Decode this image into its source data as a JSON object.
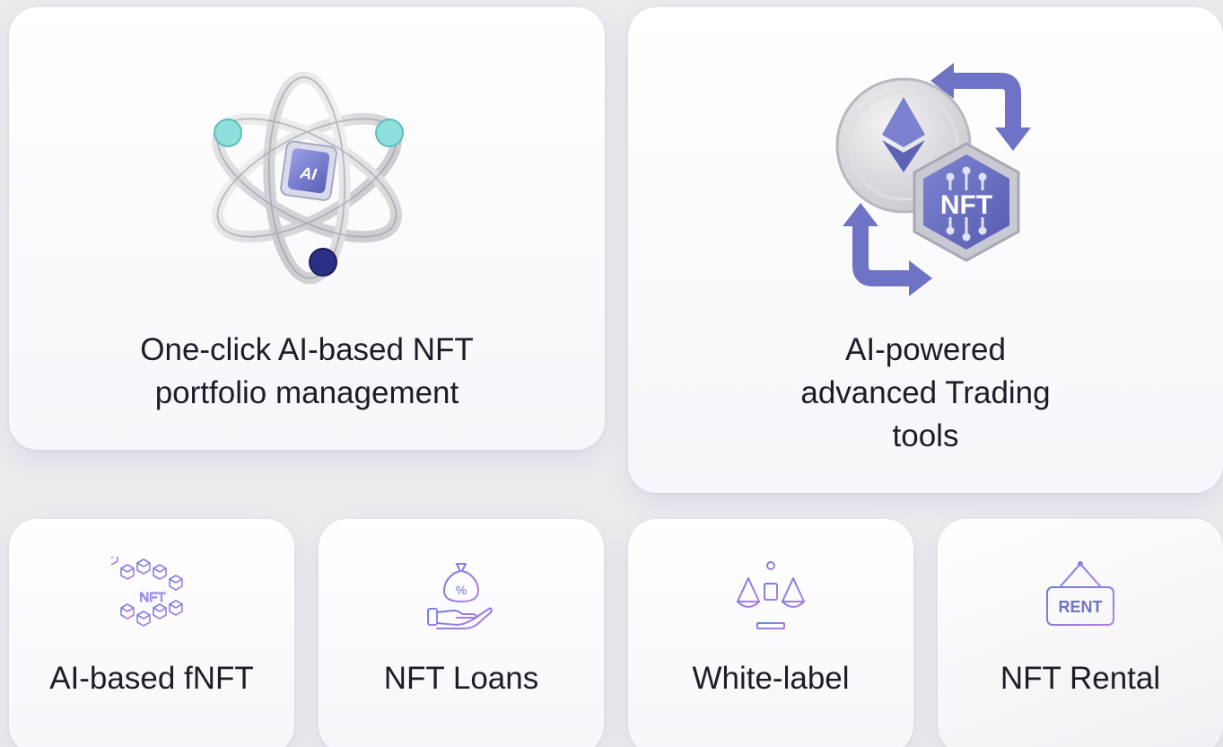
{
  "cards": {
    "portfolio": {
      "title_line1": "One-click AI-based NFT",
      "title_line2": "portfolio management",
      "icon": "atom-ai-icon",
      "badge": "AI"
    },
    "trading": {
      "title_line1": "AI-powered",
      "title_line2": "advanced Trading",
      "title_line3": "tools",
      "icon": "eth-nft-exchange-icon",
      "badge": "NFT"
    },
    "fnft": {
      "title": "AI-based fNFT",
      "icon": "nft-cubes-icon",
      "badge": "NFT"
    },
    "loans": {
      "title": "NFT Loans",
      "icon": "money-bag-hand-icon",
      "badge": "%"
    },
    "whitelabel": {
      "title": "White-label",
      "icon": "balance-scale-icon"
    },
    "rental": {
      "title": "NFT Rental",
      "icon": "rent-sign-icon",
      "badge": "RENT"
    }
  },
  "colors": {
    "accent": "#6f73c6",
    "accent_dark": "#4f53a8",
    "teal": "#8fe0dc",
    "text": "#1c1d26"
  }
}
